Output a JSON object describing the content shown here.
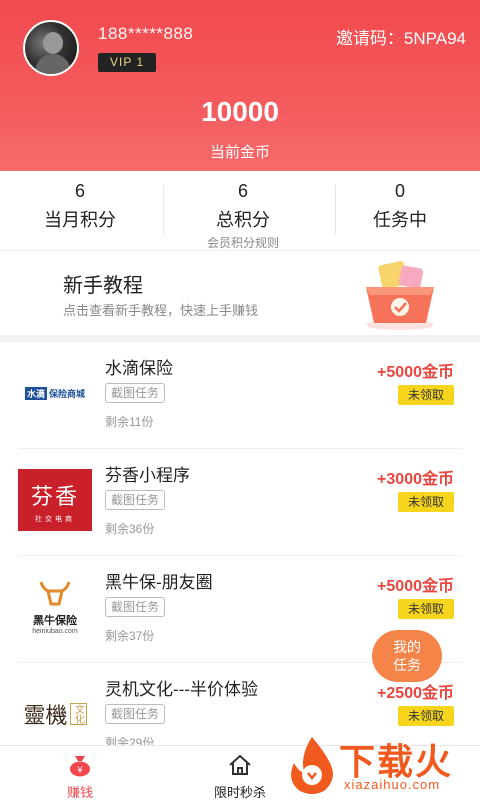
{
  "profile": {
    "phone": "188*****888",
    "vip": "VIP 1",
    "invite": "邀请码：5NPA94",
    "coins": "10000",
    "coins_label": "当前金币"
  },
  "stats": [
    {
      "num": "6",
      "label": "当月积分"
    },
    {
      "num": "6",
      "label": "总积分",
      "sub": "会员积分规则"
    },
    {
      "num": "0",
      "label": "任务中"
    }
  ],
  "tutorial": {
    "title": "新手教程",
    "desc": "点击查看新手教程，快速上手赚钱"
  },
  "tasks": [
    {
      "name": "水滴保险",
      "tag": "截图任务",
      "remain": "剩余11份",
      "reward": "+5000金币",
      "status": "未领取",
      "logo": "水滴保险商城"
    },
    {
      "name": "芬香小程序",
      "tag": "截图任务",
      "remain": "剩余36份",
      "reward": "+3000金币",
      "status": "未领取",
      "logo": "芬香",
      "logo_sub": "社交电商"
    },
    {
      "name": "黑牛保-朋友圈",
      "tag": "截图任务",
      "remain": "剩余37份",
      "reward": "+5000金币",
      "status": "未领取",
      "logo": "黑牛保险",
      "logo_sub": "heiniubao.com"
    },
    {
      "name": "灵机文化---半价体验",
      "tag": "截图任务",
      "remain": "剩余29份",
      "reward": "+2500金币",
      "status": "未领取",
      "logo": "靈機",
      "logo_sub": "文化"
    }
  ],
  "float_button": {
    "line1": "我的",
    "line2": "任务"
  },
  "nav": [
    {
      "label": "赚钱",
      "active": true
    },
    {
      "label": "限时秒杀"
    }
  ],
  "watermark": {
    "text": "下载火",
    "sub": "xiazaihuo.com"
  },
  "colors": {
    "primary": "#f24a4f",
    "reward": "#e8463e",
    "claim": "#f7d51c",
    "float": "#f47a3a"
  }
}
